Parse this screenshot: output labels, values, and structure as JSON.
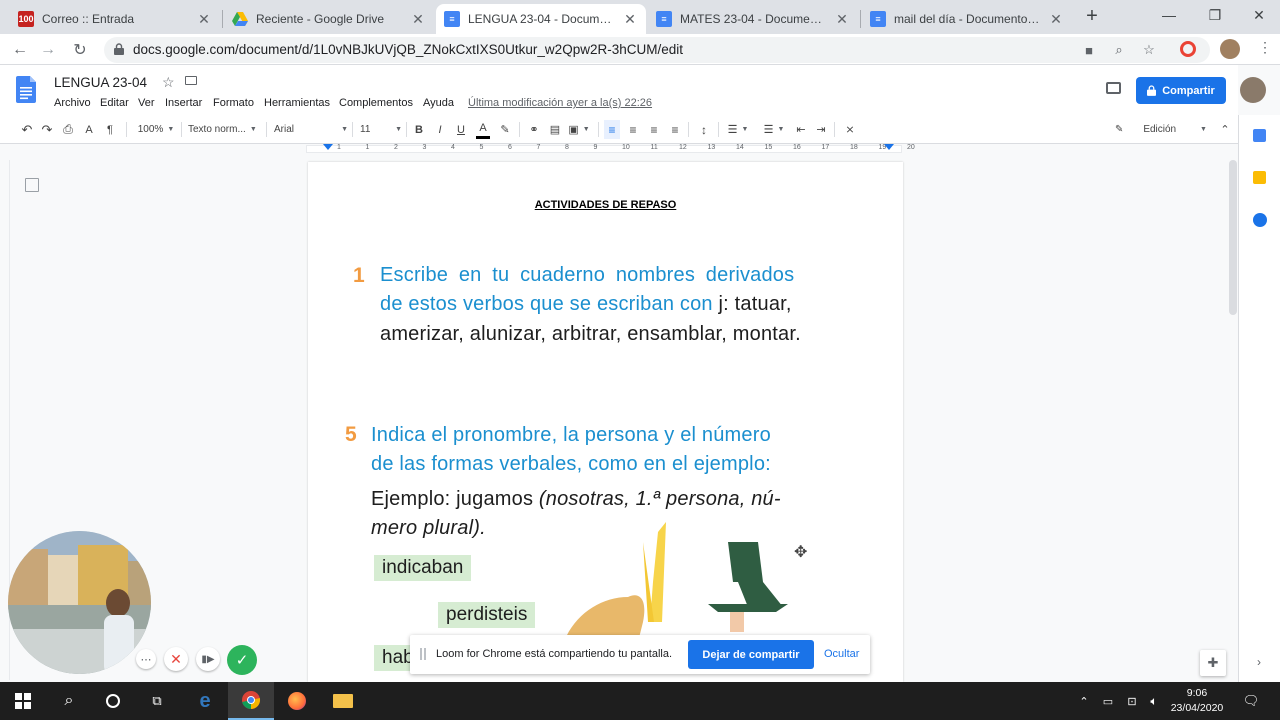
{
  "browser": {
    "tabs": [
      {
        "title": "Correo :: Entrada",
        "icon": "mail-icon",
        "close": "✕"
      },
      {
        "title": "Reciente - Google Drive",
        "icon": "drive-icon",
        "close": "✕"
      },
      {
        "title": "LENGUA 23-04 - Documentos",
        "icon": "docs-icon",
        "close": "✕"
      },
      {
        "title": "MATES 23-04 - Documentos de",
        "icon": "docs-icon",
        "close": "✕"
      },
      {
        "title": "mail del día - Documentos de",
        "icon": "docs-icon",
        "close": "✕"
      }
    ],
    "url": "docs.google.com/document/d/1L0vNBJkUVjQB_ZNokCxtIXS0Utkur_w2Qpw2R-3hCUM/edit"
  },
  "docs": {
    "title": "LENGUA 23-04",
    "menu": [
      "Archivo",
      "Editar",
      "Ver",
      "Insertar",
      "Formato",
      "Herramientas",
      "Complementos",
      "Ayuda"
    ],
    "last_edit": "Última modificación ayer a la(s) 22:26",
    "share_label": "Compartir",
    "toolbar": {
      "zoom": "100%",
      "style": "Texto norm...",
      "font": "Arial",
      "size": "11",
      "mode": "Edición"
    },
    "ruler_marks": [
      "1",
      "1",
      "2",
      "3",
      "4",
      "5",
      "6",
      "7",
      "8",
      "9",
      "10",
      "11",
      "12",
      "13",
      "14",
      "15",
      "16",
      "17",
      "18",
      "19",
      "20"
    ]
  },
  "document": {
    "heading": "ACTIVIDADES DE REPASO",
    "ex1": {
      "number": "1",
      "line1": "Escribe en tu cuaderno nombres derivados",
      "line2_blue": "de estos verbos que se escriban con",
      "line2_black": " j: tatuar,",
      "line3": "amerizar, alunizar, arbitrar, ensamblar, montar."
    },
    "ex5": {
      "number": "5",
      "line1": "Indica el pronombre, la persona y el número",
      "line2": "de las formas verbales, como en el ejemplo:",
      "example_label": "Ejemplo: jugamos ",
      "example_italic": "(nosotras, 1.ª persona, nú-",
      "example_line2": "mero plural)."
    },
    "words": [
      "indicaban",
      "perdisteis",
      "hab"
    ]
  },
  "loom": {
    "message": "Loom for Chrome está compartiendo tu pantalla.",
    "stop_label": "Dejar de compartir",
    "hide_label": "Ocultar"
  },
  "taskbar": {
    "time": "9:06",
    "date": "23/04/2020"
  }
}
